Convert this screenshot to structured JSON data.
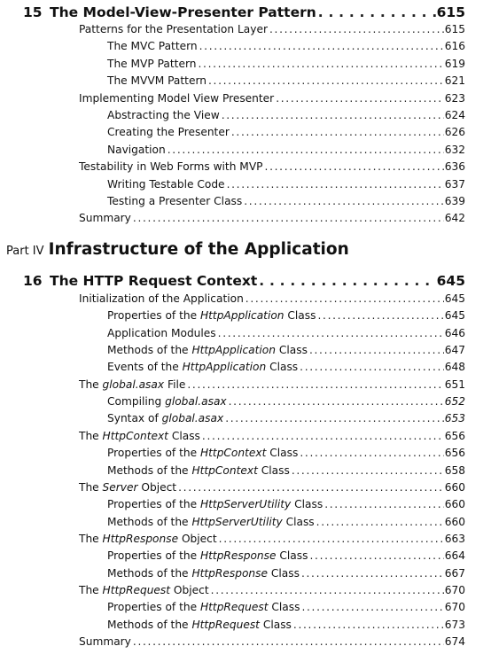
{
  "chapter15": {
    "number": "15",
    "title": "The Model-View-Presenter Pattern",
    "page": "615",
    "entries": [
      {
        "level": 1,
        "text": "Patterns for the Presentation Layer",
        "page": "615"
      },
      {
        "level": 2,
        "text": "The MVC Pattern",
        "page": "616"
      },
      {
        "level": 2,
        "text": "The MVP Pattern",
        "page": "619"
      },
      {
        "level": 2,
        "text": "The MVVM Pattern",
        "page": "621"
      },
      {
        "level": 1,
        "text": "Implementing Model View Presenter",
        "page": "623"
      },
      {
        "level": 2,
        "text": "Abstracting the View",
        "page": "624"
      },
      {
        "level": 2,
        "text": "Creating the Presenter",
        "page": "626"
      },
      {
        "level": 2,
        "text": "Navigation",
        "page": "632"
      },
      {
        "level": 1,
        "text": "Testability in Web Forms with MVP",
        "page": "636"
      },
      {
        "level": 2,
        "text": "Writing Testable Code",
        "page": "637"
      },
      {
        "level": 2,
        "text": "Testing a Presenter Class",
        "page": "639"
      },
      {
        "level": 1,
        "text": "Summary",
        "page": "642"
      }
    ]
  },
  "part": {
    "label": "Part IV",
    "title": "Infrastructure of the Application"
  },
  "chapter16": {
    "number": "16",
    "title": "The HTTP Request Context",
    "page": "645",
    "entries": [
      {
        "level": 1,
        "text": "Initialization of the Application",
        "page": "645"
      },
      {
        "level": 2,
        "pre": "Properties of the ",
        "em": "HttpApplication",
        "post": " Class",
        "page": "645"
      },
      {
        "level": 2,
        "text": "Application Modules",
        "page": "646"
      },
      {
        "level": 2,
        "pre": "Methods of the ",
        "em": "HttpApplication",
        "post": " Class",
        "page": "647"
      },
      {
        "level": 2,
        "pre": "Events of the ",
        "em": "HttpApplication",
        "post": " Class",
        "page": "648"
      },
      {
        "level": 1,
        "pre": "The ",
        "em": "global.asax",
        "post": " File",
        "page": "651"
      },
      {
        "level": 2,
        "pre": "Compiling ",
        "em": "global.asax",
        "post": "",
        "page": "652",
        "page_italic": true
      },
      {
        "level": 2,
        "pre": "Syntax of ",
        "em": "global.asax",
        "post": "",
        "page": "653",
        "page_italic": true
      },
      {
        "level": 1,
        "pre": "The ",
        "em": "HttpContext",
        "post": " Class",
        "page": "656"
      },
      {
        "level": 2,
        "pre": "Properties of the ",
        "em": "HttpContext",
        "post": " Class",
        "page": "656"
      },
      {
        "level": 2,
        "pre": "Methods of the ",
        "em": "HttpContext",
        "post": " Class",
        "page": "658"
      },
      {
        "level": 1,
        "pre": "The ",
        "em": "Server",
        "post": " Object",
        "page": "660"
      },
      {
        "level": 2,
        "pre": "Properties of the ",
        "em": "HttpServerUtility",
        "post": " Class",
        "page": "660"
      },
      {
        "level": 2,
        "pre": "Methods of the ",
        "em": "HttpServerUtility",
        "post": " Class",
        "page": "660"
      },
      {
        "level": 1,
        "pre": "The ",
        "em": "HttpResponse",
        "post": " Object",
        "page": "663"
      },
      {
        "level": 2,
        "pre": "Properties of the ",
        "em": "HttpResponse",
        "post": " Class",
        "page": "664"
      },
      {
        "level": 2,
        "pre": "Methods of the ",
        "em": "HttpResponse",
        "post": " Class",
        "page": "667"
      },
      {
        "level": 1,
        "pre": "The ",
        "em": "HttpRequest",
        "post": " Object",
        "page": "670"
      },
      {
        "level": 2,
        "pre": "Properties of the ",
        "em": "HttpRequest",
        "post": " Class",
        "page": "670"
      },
      {
        "level": 2,
        "pre": "Methods of the ",
        "em": "HttpRequest",
        "post": " Class",
        "page": "673"
      },
      {
        "level": 1,
        "text": "Summary",
        "page": "674"
      }
    ]
  }
}
